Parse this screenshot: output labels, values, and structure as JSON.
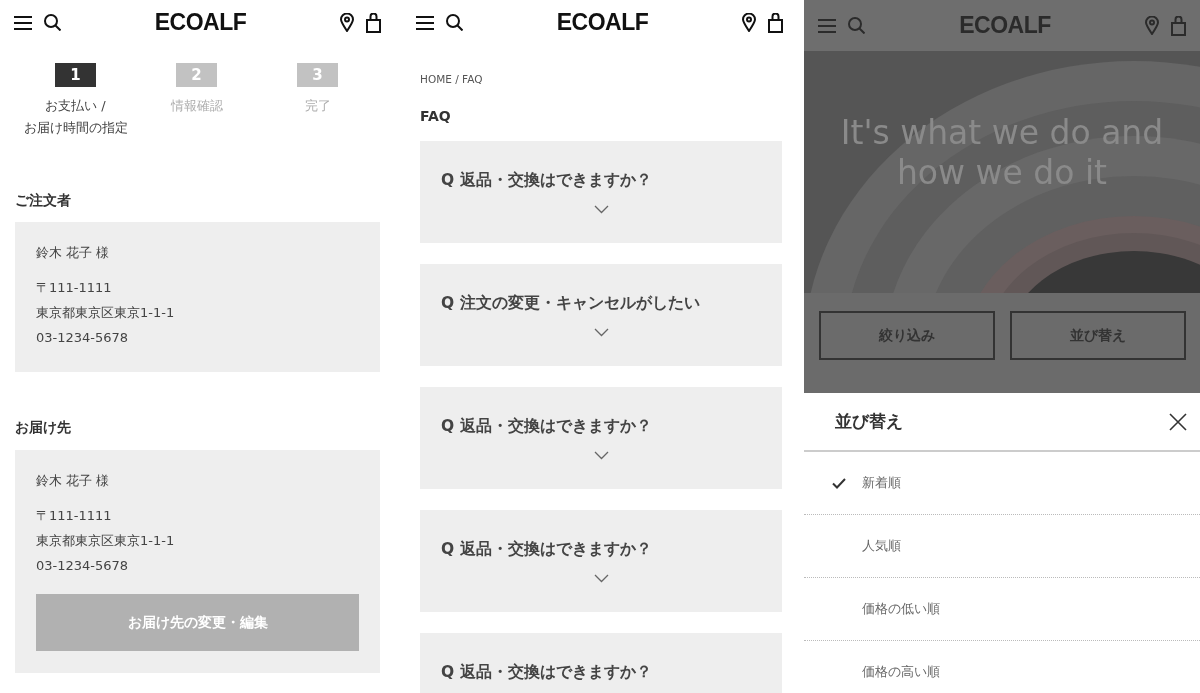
{
  "checkout_screen": {
    "header": {
      "logo": "ECOALF"
    },
    "steps": [
      {
        "number": "1",
        "label": "お支払い /\nお届け時間の指定",
        "selected": true
      },
      {
        "number": "2",
        "label": "情報確認",
        "selected": false
      },
      {
        "number": "3",
        "label": "完了",
        "selected": false
      }
    ],
    "sections": [
      {
        "title": "ご注文者",
        "name": "鈴木 花子 様",
        "lines": [
          "〒111-1111",
          "東京都東京区東京1-1-1",
          "03-1234-5678"
        ]
      },
      {
        "title": "お届け先",
        "name": "鈴木 花子 様",
        "lines": [
          "〒111-1111",
          "東京都東京区東京1-1-1",
          "03-1234-5678"
        ],
        "button": "お届け先の変更・編集"
      }
    ]
  },
  "faq_screen": {
    "header": {
      "logo": "ECOALF"
    },
    "breadcrumb": "HOME / FAQ",
    "title": "FAQ",
    "items": [
      {
        "question": "Q 返品・交換はできますか？",
        "chevron": true
      },
      {
        "question": "Q 注文の変更・キャンセルがしたい",
        "chevron": true
      },
      {
        "question": "Q 返品・交換はできますか？",
        "chevron": true
      },
      {
        "question": "Q 返品・交換はできますか？",
        "chevron": true
      },
      {
        "question": "Q 返品・交換はできますか？",
        "chevron": false
      }
    ]
  },
  "sort_screen": {
    "header": {
      "logo": "ECOALF"
    },
    "hero": {
      "kind": "picture",
      "headline": "It's what we do and how we do it"
    },
    "buttons": [
      "絞り込み",
      "並び替え"
    ],
    "sheet": {
      "title": "並び替え",
      "options": [
        {
          "label": "新着順",
          "selected": true
        },
        {
          "label": "人気順",
          "selected": false
        },
        {
          "label": "価格の低い順",
          "selected": false
        },
        {
          "label": "価格の高い順",
          "selected": false
        }
      ]
    }
  }
}
